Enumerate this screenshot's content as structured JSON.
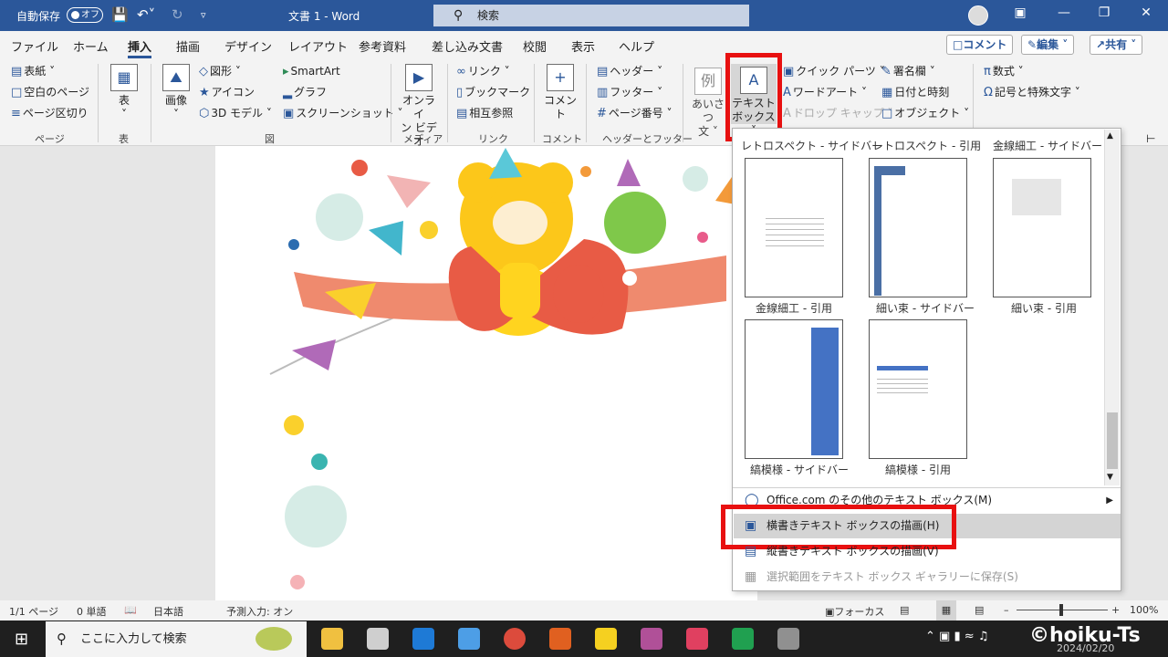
{
  "titlebar": {
    "autosave_label": "自動保存",
    "autosave_state": "オフ",
    "doc_title": "文書 1 - Word",
    "search_placeholder": "検索"
  },
  "tabs": [
    "ファイル",
    "ホーム",
    "挿入",
    "描画",
    "デザイン",
    "レイアウト",
    "参考資料",
    "差し込み文書",
    "校閲",
    "表示",
    "ヘルプ"
  ],
  "active_tab": "挿入",
  "right_buttons": {
    "comment": "コメント",
    "edit": "編集",
    "share": "共有"
  },
  "ribbon": {
    "page": {
      "cover": "表紙",
      "blank": "空白のページ",
      "break": "ページ区切り",
      "group": "ページ"
    },
    "table": {
      "label": "表",
      "group": "表"
    },
    "illust": {
      "image": "画像",
      "shapes": "図形",
      "icons": "アイコン",
      "model3d": "3D モデル",
      "smartart": "SmartArt",
      "chart": "グラフ",
      "screenshot": "スクリーンショット",
      "group": "図"
    },
    "media": {
      "online_video_1": "オンライ",
      "online_video_2": "ン ビデオ",
      "group": "メディア"
    },
    "links": {
      "link": "リンク",
      "bookmark": "ブックマーク",
      "crossref": "相互参照",
      "group": "リンク"
    },
    "comments": {
      "comment": "コメント",
      "group": "コメント"
    },
    "headerfooter": {
      "header": "ヘッダー",
      "footer": "フッター",
      "pagenum": "ページ番号",
      "group": "ヘッダーとフッター"
    },
    "text": {
      "greeting_1": "あいさつ",
      "greeting_2": "文",
      "textbox_1": "テキスト",
      "textbox_2": "ボックス",
      "quickparts": "クイック パーツ",
      "wordart": "ワードアート",
      "dropcap": "ドロップ キャップ",
      "sigline": "署名欄",
      "datetime": "日付と時刻",
      "object": "オブジェクト"
    },
    "symbols": {
      "equation": "数式",
      "symbol": "記号と特殊文字"
    }
  },
  "gallery": {
    "top_captions": [
      "レトロスペクト - サイドバー",
      "レトロスペクト - 引用",
      "金線細工 - サイドバー"
    ],
    "row1": [
      "金線細工 - 引用",
      "細い束 - サイドバー",
      "細い束 - 引用"
    ],
    "row2": [
      "縞模様 - サイドバー",
      "縞模様 - 引用"
    ]
  },
  "menu": {
    "more": "Office.com のその他のテキスト ボックス(M)",
    "draw_horizontal": "横書きテキスト ボックスの描画(H)",
    "draw_vertical": "縦書きテキスト ボックスの描画(V)",
    "save_selection": "選択範囲をテキスト ボックス ギャラリーに保存(S)"
  },
  "status": {
    "page": "1/1 ページ",
    "words": "0 単語",
    "lang": "日本語",
    "predict": "予測入力: オン",
    "focus": "フォーカス",
    "zoom": "100%"
  },
  "taskbar": {
    "search": "ここに入力して検索",
    "date": "2024/02/20"
  },
  "watermark": "©hoiku-Ts",
  "colors": {
    "word_blue": "#2b579a",
    "highlight_red": "#e81010"
  }
}
